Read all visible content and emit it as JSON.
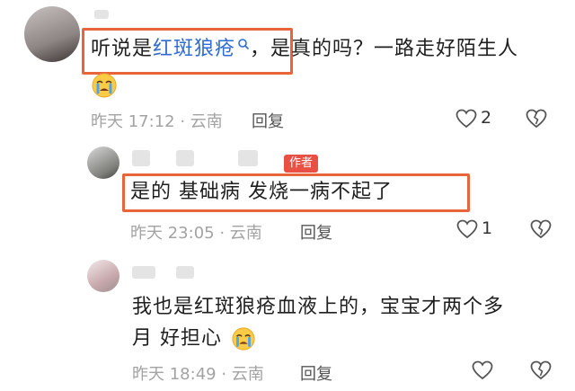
{
  "comments": [
    {
      "text_before": "听说是",
      "link": "红斑狼疮",
      "text_after": "，是真的吗？一路走好陌生人",
      "meta": "昨天 17:12 · 云南",
      "reply_label": "回复",
      "like_count": "2"
    },
    {
      "author_tag": "作者",
      "text": "是的 基础病 发烧一病不起了",
      "meta": "昨天 23:05 · 云南",
      "reply_label": "回复",
      "like_count": "1"
    },
    {
      "text_line1": "我也是红斑狼疮血液上的，宝宝才两个多",
      "text_line2": "月  好担心",
      "meta": "昨天 18:49 · 云南",
      "reply_label": "回复"
    }
  ],
  "icons": [
    "crying-emoji-icon",
    "heart-icon",
    "heart-broken-icon",
    "search-icon"
  ],
  "colors": {
    "highlight": "#e8643a",
    "link": "#2f6bd3",
    "author_tag": "#ea4f43"
  }
}
